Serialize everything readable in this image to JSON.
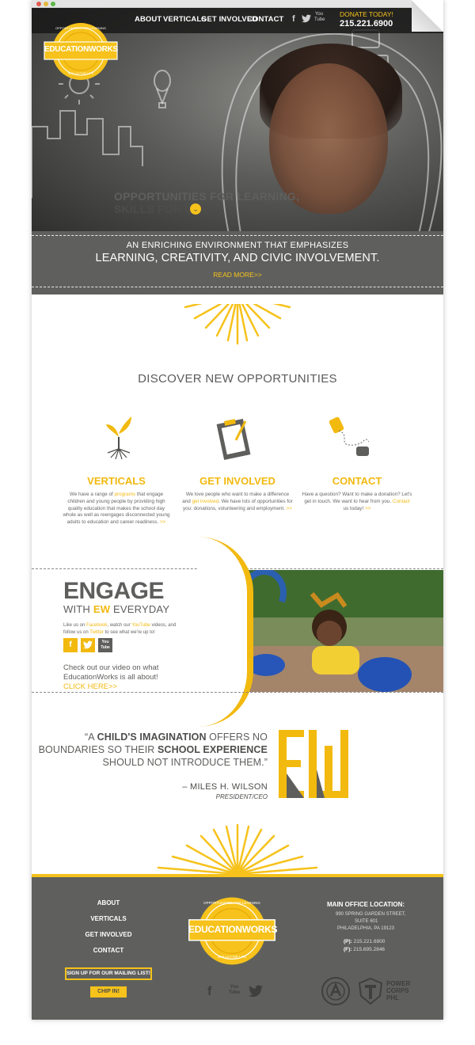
{
  "nav": {
    "items": [
      "ABOUT",
      "VERTICALS",
      "GET INVOLVED",
      "CONTACT"
    ],
    "donate": "DONATE TODAY!",
    "phone": "215.221.6900",
    "social": [
      "f",
      "t",
      "You Tube"
    ]
  },
  "logo": {
    "ring_top": "OPPORTUNITIES FOR LEARNING",
    "name": "EDUCATIONWORKS",
    "ring_bottom": "SKILLS FOR LIFE"
  },
  "hero": {
    "tagline_line1": "OPPORTUNITIES FOR LEARNING,",
    "tagline_line2": "SKILLS FOR LIFE.",
    "band_line1": "AN ENRICHING ENVIRONMENT THAT EMPHASIZES",
    "band_line2": "LEARNING, CREATIVITY, AND CIVIC INVOLVEMENT.",
    "read_more": "READ MORE>>"
  },
  "discover": {
    "title": "DISCOVER NEW OPPORTUNITIES",
    "columns": [
      {
        "title": "VERTICALS",
        "text_a": "We have a range of ",
        "link": "programs",
        "text_b": " that engage children and young people by providing high quality education that makes the school day whole as well as reengages disconnected young adults to education and career readiness.",
        "more": ">>"
      },
      {
        "title": "GET INVOLVED",
        "text_a": "We love people who want to make a difference and ",
        "link": "get involved",
        "text_b": ". We have lots of opportunities for you: donations, volunteering and employment.",
        "more": ">>"
      },
      {
        "title": "CONTACT",
        "text_a": "Have a question? Want to make a donation? Let's get in touch. We want to hear from you. ",
        "link": "Contact",
        "text_b": " us today!",
        "more": ">>"
      }
    ]
  },
  "engage": {
    "title": "ENGAGE",
    "sub_a": "WITH ",
    "sub_b": "EW",
    "sub_c": " EVERYDAY",
    "text_a": "Like us on ",
    "facebook": "Facebook",
    "text_b": ", watch our ",
    "youtube": "YouTube",
    "text_c": " videos, and follow us on ",
    "twitter": "Twitter",
    "text_d": " to see what we're up to!",
    "video_text": "Check out our video on what EducationWorks is all about!",
    "click_here": "CLICK HERE>>"
  },
  "quote": {
    "open": "“A ",
    "b1": "CHILD'S IMAGINATION",
    "t1": " OFFERS NO",
    "line2_a": "BOUNDARIES SO THEIR ",
    "b2": "SCHOOL EXPERIENCE",
    "line3": "SHOULD NOT INTRODUCE THEM.”",
    "author": "– MILES H. WILSON",
    "role": "PRESIDENT/CEO",
    "monogram": "EW"
  },
  "footer": {
    "links": [
      "ABOUT",
      "VERTICALS",
      "GET INVOLVED",
      "CONTACT"
    ],
    "signup": "SIGN UP FOR OUR MAILING LIST!",
    "chip_in": "CHIP IN!",
    "main_office": "MAIN OFFICE LOCATION:",
    "address": [
      "990 SPRING GARDEN STREET,",
      "SUITE 601",
      "PHILADELPHIA, PA 19123"
    ],
    "phone_label": "(P):",
    "phone": "215.221.6900",
    "fax_label": "(F):",
    "fax": "215.695.2846",
    "partner": "POWER CORPS PHL"
  },
  "colors": {
    "accent": "#f6c21b",
    "gray_band": "#5f605d",
    "text_dark": "#5e5e5c"
  }
}
